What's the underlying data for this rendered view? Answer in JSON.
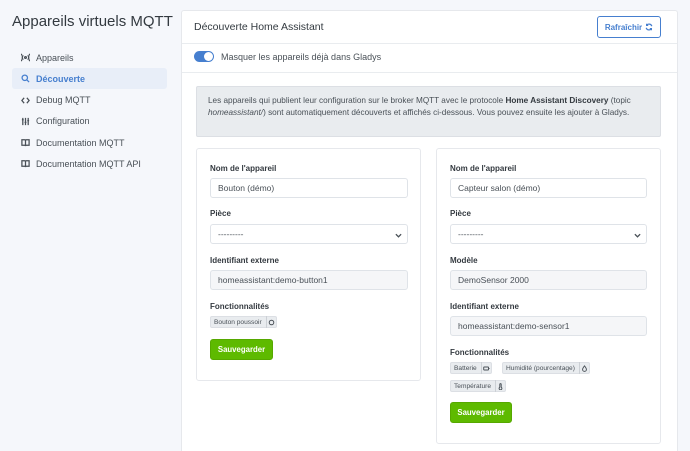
{
  "app": {
    "title": "Appareils virtuels MQTT"
  },
  "sidebar": {
    "items": [
      {
        "label": "Appareils",
        "icon": "broadcast-icon",
        "active": false
      },
      {
        "label": "Découverte",
        "icon": "search-icon",
        "active": true
      },
      {
        "label": "Debug MQTT",
        "icon": "code-icon",
        "active": false
      },
      {
        "label": "Configuration",
        "icon": "sliders-icon",
        "active": false
      },
      {
        "label": "Documentation MQTT",
        "icon": "book-icon",
        "active": false
      },
      {
        "label": "Documentation MQTT API",
        "icon": "book-icon",
        "active": false
      }
    ]
  },
  "main": {
    "title": "Découverte Home Assistant",
    "refresh_label": "Rafraîchir",
    "toggle_label": "Masquer les appareils déjà dans Gladys",
    "toggle_on": true,
    "alert": {
      "part1": "Les appareils qui publient leur configuration sur le broker MQTT avec le protocole ",
      "bold": "Home Assistant Discovery",
      "part2": " (topic ",
      "italic": "homeassistant/",
      "part3": ") sont automatiquement découverts et affichés ci-dessous. Vous pouvez ensuite les ajouter à Gladys."
    }
  },
  "devices": [
    {
      "name_label": "Nom de l'appareil",
      "name_value": "Bouton (démo)",
      "room_label": "Pièce",
      "room_value": "---------",
      "external_id_label": "Identifiant externe",
      "external_id_value": "homeassistant:demo-button1",
      "features_label": "Fonctionnalités",
      "features": [
        {
          "label": "Bouton poussoir",
          "icon": "circle-icon"
        }
      ],
      "save_label": "Sauvegarder"
    },
    {
      "name_label": "Nom de l'appareil",
      "name_value": "Capteur salon (démo)",
      "room_label": "Pièce",
      "room_value": "---------",
      "model_label": "Modèle",
      "model_value": "DemoSensor 2000",
      "external_id_label": "Identifiant externe",
      "external_id_value": "homeassistant:demo-sensor1",
      "features_label": "Fonctionnalités",
      "features": [
        {
          "label": "Batterie",
          "icon": "battery-icon"
        },
        {
          "label": "Humidité (pourcentage)",
          "icon": "droplet-icon"
        },
        {
          "label": "Température",
          "icon": "thermometer-icon"
        }
      ],
      "save_label": "Sauvegarder"
    }
  ],
  "colors": {
    "accent": "#467fcf",
    "success": "#5eba00",
    "background": "#f5f7fb"
  }
}
